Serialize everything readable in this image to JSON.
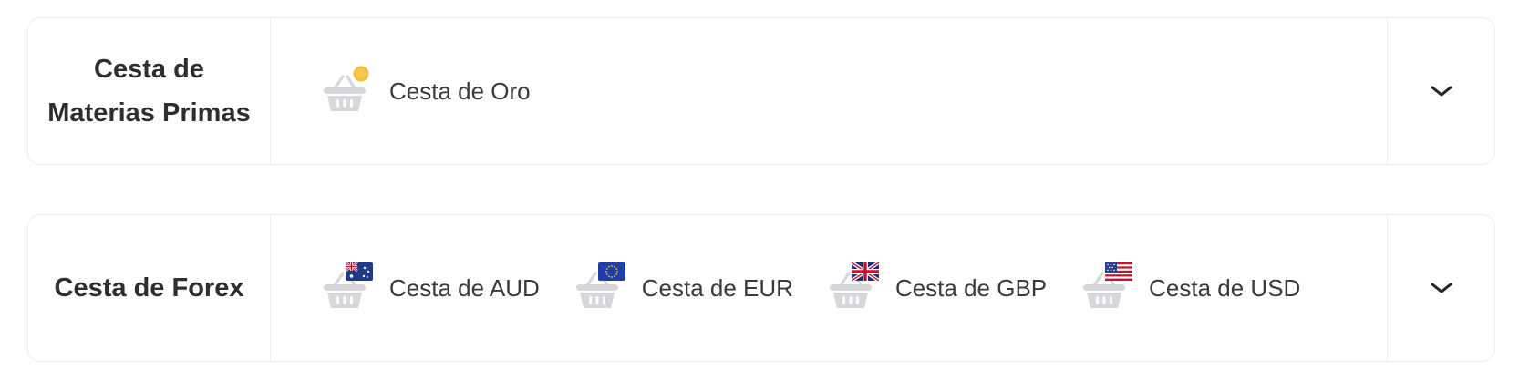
{
  "sections": [
    {
      "title_line1": "Cesta de",
      "title_line2": "Materias Primas",
      "items": [
        {
          "label": "Cesta de Oro",
          "badge": "gold-coin"
        }
      ]
    },
    {
      "title_line1": "Cesta de Forex",
      "title_line2": "",
      "items": [
        {
          "label": "Cesta de AUD",
          "badge": "australia-flag"
        },
        {
          "label": "Cesta de EUR",
          "badge": "eu-flag"
        },
        {
          "label": "Cesta de GBP",
          "badge": "uk-flag"
        },
        {
          "label": "Cesta de USD",
          "badge": "us-flag"
        }
      ]
    }
  ],
  "icons": {
    "basket": "basket-icon",
    "toggle": "chevron-down-icon"
  },
  "colors": {
    "basket_gray": "#d7d7db",
    "gold": "#f3bf3a",
    "border": "#ececec",
    "text": "#2e2e2e"
  }
}
